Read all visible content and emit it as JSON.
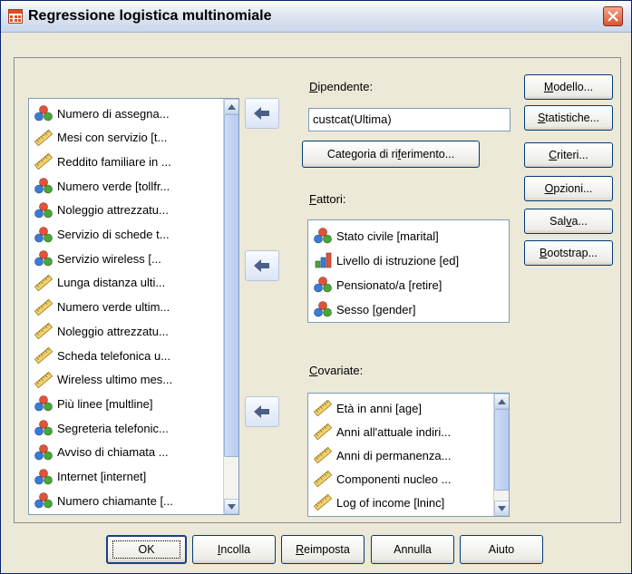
{
  "window": {
    "title": "Regressione logistica multinomiale"
  },
  "colors": {
    "nominal_icon": "#3a7bd5",
    "scale_icon": "#d8b33a",
    "ordinal_icon": "#c0392b",
    "button_border": "#003c74"
  },
  "source_list": {
    "items": [
      {
        "label": "Numero di assegna...",
        "icon": "nominal-icon"
      },
      {
        "label": "Mesi con servizio [t...",
        "icon": "scale-icon"
      },
      {
        "label": "Reddito familiare in ...",
        "icon": "scale-icon"
      },
      {
        "label": "Numero verde [tollfr...",
        "icon": "nominal-icon"
      },
      {
        "label": "Noleggio attrezzatu...",
        "icon": "nominal-icon"
      },
      {
        "label": "Servizio di schede t...",
        "icon": "nominal-icon"
      },
      {
        "label": "Servizio wireless [...",
        "icon": "nominal-icon"
      },
      {
        "label": "Lunga distanza ulti...",
        "icon": "scale-icon"
      },
      {
        "label": "Numero verde ultim...",
        "icon": "scale-icon"
      },
      {
        "label": "Noleggio attrezzatu...",
        "icon": "scale-icon"
      },
      {
        "label": "Scheda telefonica u...",
        "icon": "scale-icon"
      },
      {
        "label": "Wireless ultimo mes...",
        "icon": "scale-icon"
      },
      {
        "label": "Più linee [multline]",
        "icon": "nominal-icon"
      },
      {
        "label": "Segreteria telefonic...",
        "icon": "nominal-icon"
      },
      {
        "label": "Avviso di chiamata ...",
        "icon": "nominal-icon"
      },
      {
        "label": "Internet [internet]",
        "icon": "nominal-icon"
      },
      {
        "label": "Numero chiamante [...",
        "icon": "nominal-icon"
      }
    ]
  },
  "dependent": {
    "label": "Dipendente:",
    "mnemonic": "D",
    "rest": "ipendente:",
    "value": "custcat(Ultima)",
    "ref_button": {
      "before": "Categoria di ri",
      "mnemonic": "f",
      "after": "erimento..."
    }
  },
  "factors": {
    "label_mnemonic": "F",
    "label_rest": "attori:",
    "items": [
      {
        "label": "Stato civile [marital]",
        "icon": "nominal-icon"
      },
      {
        "label": "Livello di istruzione [ed]",
        "icon": "ordinal-icon"
      },
      {
        "label": "Pensionato/a [retire]",
        "icon": "nominal-icon"
      },
      {
        "label": "Sesso [gender]",
        "icon": "nominal-icon"
      }
    ]
  },
  "covariates": {
    "label_mnemonic": "C",
    "label_rest": "ovariate:",
    "items": [
      {
        "label": "Età in anni [age]",
        "icon": "scale-icon"
      },
      {
        "label": "Anni all'attuale indiri...",
        "icon": "scale-icon"
      },
      {
        "label": "Anni di permanenza...",
        "icon": "scale-icon"
      },
      {
        "label": "Componenti nucleo ...",
        "icon": "scale-icon"
      },
      {
        "label": "Log of income [lninc]",
        "icon": "scale-icon"
      }
    ]
  },
  "side_buttons": [
    {
      "id": "modello",
      "mnemonic": "M",
      "rest": "odello..."
    },
    {
      "id": "statistiche",
      "mnemonic": "S",
      "rest": "tatistiche..."
    },
    {
      "id": "criteri",
      "mnemonic": "C",
      "rest": "riteri..."
    },
    {
      "id": "opzioni",
      "mnemonic": "O",
      "rest": "pzioni..."
    },
    {
      "id": "salva",
      "pre": "Sal",
      "mnemonic": "v",
      "rest": "a..."
    },
    {
      "id": "bootstrap",
      "mnemonic": "B",
      "rest": "ootstrap..."
    }
  ],
  "bottom_buttons": [
    {
      "id": "ok",
      "label": "OK"
    },
    {
      "id": "incolla",
      "mnemonic": "I",
      "rest": "ncolla"
    },
    {
      "id": "reimposta",
      "mnemonic": "R",
      "rest": "eimposta"
    },
    {
      "id": "annulla",
      "label": "Annulla"
    },
    {
      "id": "aiuto",
      "label": "Aiuto"
    }
  ]
}
